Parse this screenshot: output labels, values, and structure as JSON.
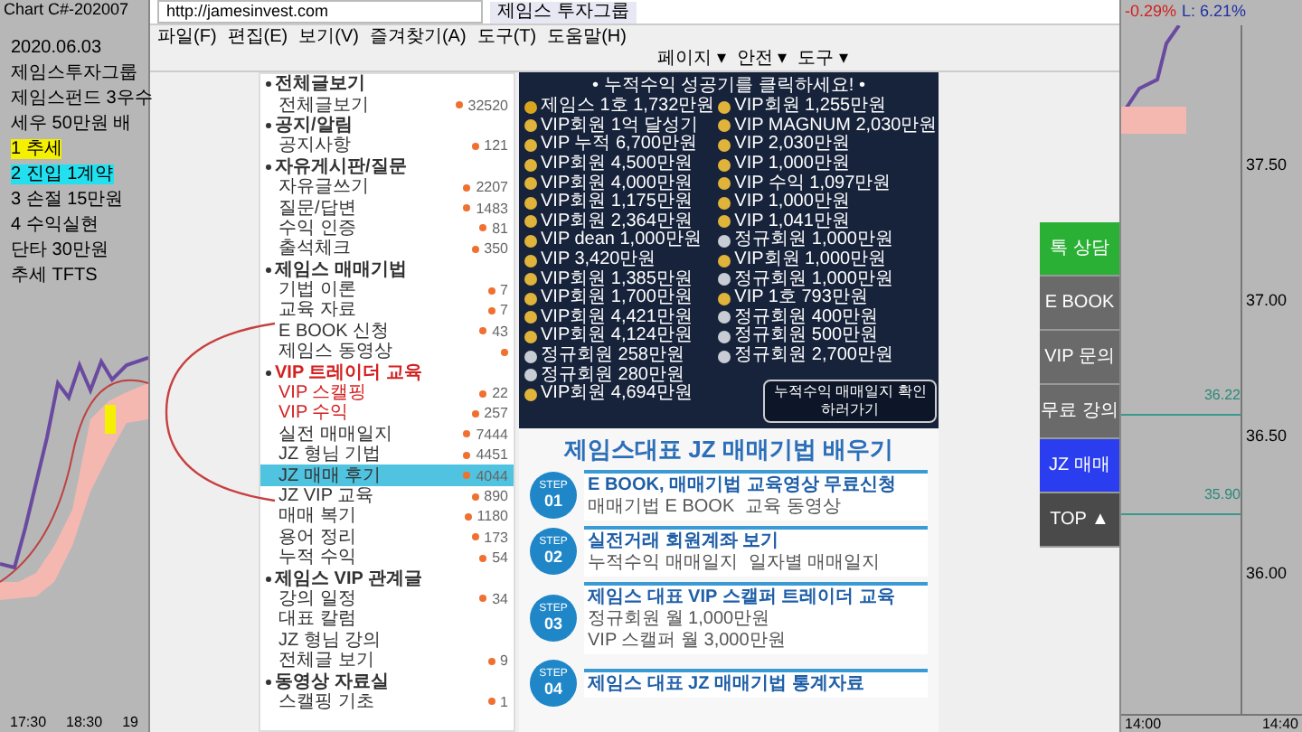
{
  "left_chart": {
    "title": "Chart C#-202007",
    "notes": [
      {
        "text": "2020.06.03"
      },
      {
        "text": "제임스투자그룹"
      },
      {
        "text": "제임스펀드 3우수"
      },
      {
        "text": "세우 50만원 배"
      },
      {
        "text": "1 추세",
        "color": "#f5f000"
      },
      {
        "text": "2 진입 1계약",
        "color": "#22e0f0"
      },
      {
        "text": "3 손절 15만원"
      },
      {
        "text": "4 수익실현"
      },
      {
        "text": "단타 30만원"
      },
      {
        "text": "추세 TFTS"
      }
    ],
    "time_labels": [
      "17:30",
      "18:30",
      "19"
    ]
  },
  "browser": {
    "address": "http://jamesinvest.com",
    "tab": "제임스 투자그룹",
    "menu": [
      "파일(F)",
      "편집(E)",
      "보기(V)",
      "즐겨찾기(A)",
      "도구(T)",
      "도움말(H)"
    ],
    "toolbar": [
      "페이지 ▾",
      "안전 ▾",
      "도구 ▾"
    ]
  },
  "sidebar": {
    "items": [
      {
        "kind": "header",
        "label": "전체글보기",
        "new": false,
        "accent": false,
        "selected": false
      },
      {
        "kind": "item",
        "label": "전체글보기",
        "count": "32520",
        "new": true,
        "accent": false,
        "selected": false
      },
      {
        "kind": "header",
        "label": "공지/알림",
        "new": false,
        "accent": false,
        "selected": false
      },
      {
        "kind": "item",
        "label": "공지사항",
        "count": "121",
        "new": true,
        "accent": false,
        "selected": false
      },
      {
        "kind": "header",
        "label": "자유게시판/질문",
        "new": false,
        "accent": false,
        "selected": false
      },
      {
        "kind": "item",
        "label": "자유글쓰기",
        "count": "2207",
        "new": true,
        "accent": false,
        "selected": false
      },
      {
        "kind": "item",
        "label": "질문/답변",
        "count": "1483",
        "new": true,
        "accent": false,
        "selected": false
      },
      {
        "kind": "item",
        "label": "수익 인증",
        "count": "81",
        "new": true,
        "accent": false,
        "selected": false
      },
      {
        "kind": "item",
        "label": "출석체크",
        "count": "350",
        "new": true,
        "accent": false,
        "selected": false
      },
      {
        "kind": "header",
        "label": "제임스 매매기법",
        "new": false,
        "accent": false,
        "selected": false
      },
      {
        "kind": "item",
        "label": "기법 이론",
        "count": "7",
        "new": true,
        "accent": false,
        "selected": false
      },
      {
        "kind": "item",
        "label": "교육 자료",
        "count": "7",
        "new": true,
        "accent": false,
        "selected": false
      },
      {
        "kind": "item",
        "label": "E BOOK 신청",
        "count": "43",
        "new": true,
        "accent": false,
        "selected": false
      },
      {
        "kind": "item",
        "label": "제임스 동영상",
        "new": true,
        "accent": false,
        "selected": false
      },
      {
        "kind": "header",
        "label": "VIP 트레이더 교육",
        "new": false,
        "accent": true,
        "selected": false
      },
      {
        "kind": "item",
        "label": "VIP 스캘핑",
        "count": "22",
        "new": true,
        "accent": true,
        "selected": false
      },
      {
        "kind": "item",
        "label": "VIP 수익",
        "count": "257",
        "new": true,
        "accent": true,
        "selected": false
      },
      {
        "kind": "item",
        "label": "실전 매매일지",
        "count": "7444",
        "new": true,
        "accent": false,
        "selected": false
      },
      {
        "kind": "item",
        "label": "JZ 형님 기법",
        "count": "4451",
        "new": true,
        "accent": false,
        "selected": false
      },
      {
        "kind": "item",
        "label": "JZ 매매 후기",
        "count": "4044",
        "new": true,
        "accent": false,
        "selected": true
      },
      {
        "kind": "item",
        "label": "JZ VIP 교육",
        "count": "890",
        "new": true,
        "accent": false,
        "selected": false
      },
      {
        "kind": "item",
        "label": "매매 복기",
        "count": "1180",
        "new": true,
        "accent": false,
        "selected": false
      },
      {
        "kind": "item",
        "label": "용어 정리",
        "count": "173",
        "new": true,
        "accent": false,
        "selected": false
      },
      {
        "kind": "item",
        "label": "누적 수익",
        "count": "54",
        "new": true,
        "accent": false,
        "selected": false
      },
      {
        "kind": "header",
        "label": "제임스 VIP 관계글",
        "new": false,
        "accent": false,
        "selected": false
      },
      {
        "kind": "item",
        "label": "강의 일정",
        "count": "34",
        "new": true,
        "accent": false,
        "selected": false
      },
      {
        "kind": "item",
        "label": "대표 칼럼",
        "new": false,
        "accent": false,
        "selected": false
      },
      {
        "kind": "item",
        "label": "JZ 형님 강의",
        "new": false,
        "accent": false,
        "selected": false
      },
      {
        "kind": "item",
        "label": "전체글 보기",
        "count": "9",
        "new": true,
        "accent": false,
        "selected": false
      },
      {
        "kind": "header",
        "label": "동영상 자료실",
        "new": false,
        "accent": false,
        "selected": false
      },
      {
        "kind": "item",
        "label": "스캘핑 기초",
        "count": "1",
        "new": true,
        "accent": false,
        "selected": false
      }
    ]
  },
  "banner": {
    "title": "• 누적수익 성공기를 클릭하세요! •",
    "columns": [
      [
        {
          "kind": "trophy",
          "text": "제임스 1호 1,732만원"
        },
        {
          "kind": "gold",
          "text": "VIP회원 1억 달성기"
        },
        {
          "kind": "gold",
          "text": "VIP 누적 6,700만원"
        },
        {
          "kind": "gold",
          "text": "VIP회원 4,500만원"
        },
        {
          "kind": "gold",
          "text": "VIP회원 4,000만원"
        },
        {
          "kind": "gold",
          "text": "VIP회원 1,175만원"
        },
        {
          "kind": "gold",
          "text": "VIP회원 2,364만원"
        },
        {
          "kind": "gold",
          "text": "VIP dean 1,000만원"
        },
        {
          "kind": "gold",
          "text": "VIP 3,420만원"
        },
        {
          "kind": "gold",
          "text": "VIP회원 1,385만원"
        },
        {
          "kind": "gold",
          "text": "VIP회원 1,700만원"
        },
        {
          "kind": "gold",
          "text": "VIP회원 4,421만원"
        },
        {
          "kind": "gold",
          "text": "VIP회원 4,124만원"
        },
        {
          "kind": "silver",
          "text": "정규회원 258만원"
        },
        {
          "kind": "silver",
          "text": "정규회원 280만원"
        },
        {
          "kind": "gold",
          "text": "VIP회원 4,694만원"
        }
      ],
      [
        {
          "kind": "gold",
          "text": "VIP회원 1,255만원"
        },
        {
          "kind": "gold",
          "text": "VIP MAGNUM 2,030만원"
        },
        {
          "kind": "gold",
          "text": "VIP 2,030만원"
        },
        {
          "kind": "gold",
          "text": "VIP 1,000만원"
        },
        {
          "kind": "gold",
          "text": "VIP 수익 1,097만원"
        },
        {
          "kind": "gold",
          "text": "VIP 1,000만원"
        },
        {
          "kind": "gold",
          "text": "VIP 1,041만원"
        },
        {
          "kind": "silver",
          "text": "정규회원 1,000만원"
        },
        {
          "kind": "gold",
          "text": "VIP회원 1,000만원"
        },
        {
          "kind": "silver",
          "text": "정규회원 1,000만원"
        },
        {
          "kind": "gold",
          "text": "VIP 1호 793만원"
        },
        {
          "kind": "silver",
          "text": "정규회원 400만원"
        },
        {
          "kind": "silver",
          "text": "정규회원 500만원"
        },
        {
          "kind": "silver",
          "text": "정규회원 2,700만원"
        }
      ]
    ],
    "button": "누적수익 매매일지 확인하러가기"
  },
  "education": {
    "title": "제임스대표 JZ 매매기법 배우기",
    "steps": [
      {
        "badge": "STEP",
        "number": "01",
        "title": "E BOOK, 매매기법 교육영상 무료신청",
        "links": [
          "매매기법 E BOOK",
          "교육 동영상"
        ]
      },
      {
        "badge": "STEP",
        "number": "02",
        "title": "실전거래 회원계좌 보기",
        "links": [
          "누적수익 매매일지",
          "일자별 매매일지"
        ]
      },
      {
        "badge": "STEP",
        "number": "03",
        "title": "제임스 대표 VIP 스캘퍼 트레이더 교육",
        "links": [
          "정규회원 월 1,000만원",
          "VIP 스캘퍼 월 3,000만원"
        ]
      },
      {
        "badge": "STEP",
        "number": "04",
        "title": "제임스 대표 JZ 매매기법 통계자료"
      }
    ]
  },
  "floating_bar": [
    {
      "kind": "green",
      "text": "톡 상담"
    },
    {
      "kind": "gray",
      "text": "E BOOK"
    },
    {
      "kind": "gray",
      "text": "VIP 문의"
    },
    {
      "kind": "gray",
      "text": "무료 강의"
    },
    {
      "kind": "blue",
      "text": "JZ 매매"
    },
    {
      "kind": "dark",
      "text": "TOP ▲"
    }
  ],
  "right_chart": {
    "change": "-0.29%",
    "range": "L: 6.21%",
    "prices": [
      "37.50",
      "37.00",
      "36.50",
      "36.00"
    ],
    "line_labels": [
      "36.22",
      "35.90"
    ],
    "time_labels": [
      "14:00",
      "14:40"
    ]
  }
}
